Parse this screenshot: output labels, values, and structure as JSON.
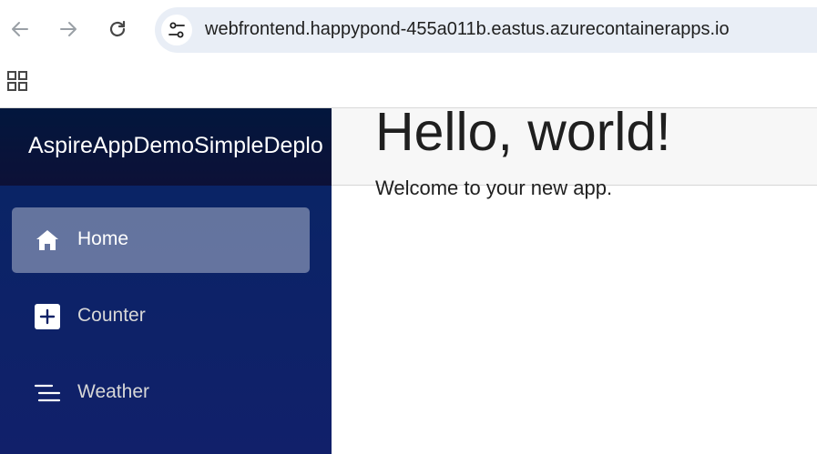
{
  "browser": {
    "url": "webfrontend.happypond-455a011b.eastus.azurecontainerapps.io",
    "icons": {
      "back": "arrow-left-icon",
      "forward": "arrow-right-icon",
      "reload": "reload-icon",
      "site_info": "tune-icon",
      "apps": "apps-grid-icon"
    }
  },
  "app": {
    "brand": "AspireAppDemoSimpleDeplo",
    "nav": {
      "items": [
        {
          "label": "Home",
          "icon": "house-icon",
          "active": true
        },
        {
          "label": "Counter",
          "icon": "plus-square-icon",
          "active": false
        },
        {
          "label": "Weather",
          "icon": "list-lines-icon",
          "active": false
        }
      ]
    },
    "main": {
      "heading": "Hello, world!",
      "text": "Welcome to your new app."
    }
  },
  "colors": {
    "sidebar_top": "#052767",
    "sidebar_bottom": "#3a0647",
    "active_item": "rgba(255,255,255,0.37)",
    "omnibox": "#e9eef6"
  }
}
